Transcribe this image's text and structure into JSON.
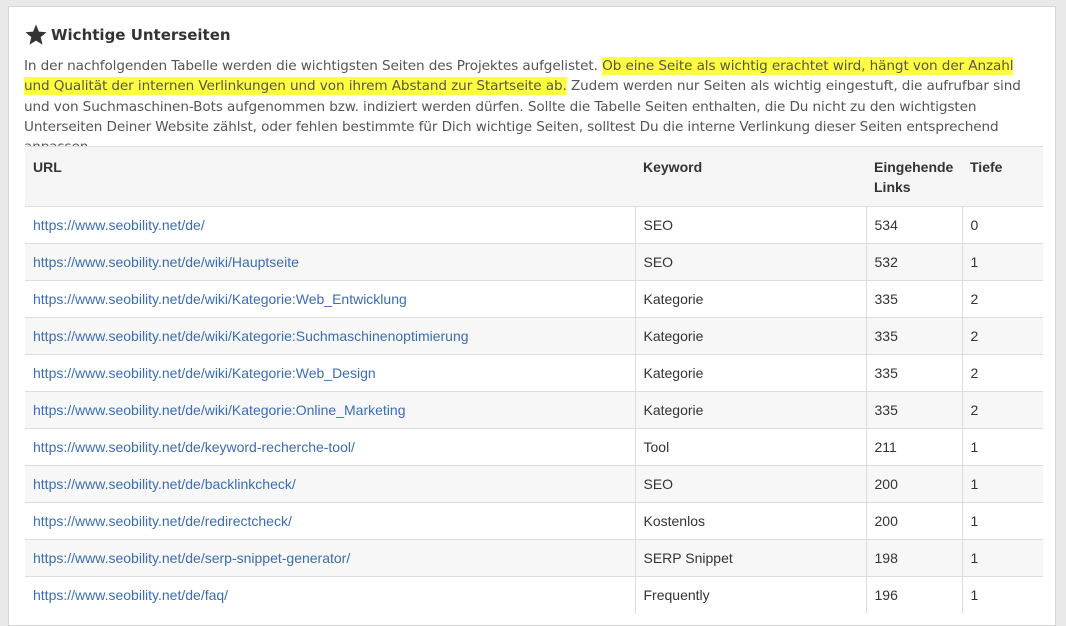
{
  "section": {
    "title": "Wichtige Unterseiten",
    "intro_part1": "In der nachfolgenden Tabelle werden die wichtigsten Seiten des Projektes aufgelistet. ",
    "intro_highlight": "Ob eine Seite als wichtig erachtet wird, hängt von der Anzahl und Qualität der internen Verlinkungen und von ihrem Abstand zur Startseite ab.",
    "intro_part2": " Zudem werden nur Seiten als wichtig eingestuft, die aufrufbar sind und von Suchmaschinen-Bots aufgenommen bzw. indiziert werden dürfen. Sollte die Tabelle Seiten enthalten, die Du nicht zu den wichtigsten Unterseiten Deiner Website zählst, oder fehlen bestimmte für Dich wichtige Seiten, solltest Du die interne Verlinkung dieser Seiten entsprechend anpassen.",
    "highlight_color": "#ffff40",
    "link_color": "#3a6db5"
  },
  "table": {
    "headers": {
      "url": "URL",
      "keyword": "Keyword",
      "links": "Eingehende Links",
      "depth": "Tiefe"
    },
    "rows": [
      {
        "url": "https://www.seobility.net/de/",
        "keyword": "SEO",
        "links": "534",
        "depth": "0"
      },
      {
        "url": "https://www.seobility.net/de/wiki/Hauptseite",
        "keyword": "SEO",
        "links": "532",
        "depth": "1"
      },
      {
        "url": "https://www.seobility.net/de/wiki/Kategorie:Web_Entwicklung",
        "keyword": "Kategorie",
        "links": "335",
        "depth": "2"
      },
      {
        "url": "https://www.seobility.net/de/wiki/Kategorie:Suchmaschinenoptimierung",
        "keyword": "Kategorie",
        "links": "335",
        "depth": "2"
      },
      {
        "url": "https://www.seobility.net/de/wiki/Kategorie:Web_Design",
        "keyword": "Kategorie",
        "links": "335",
        "depth": "2"
      },
      {
        "url": "https://www.seobility.net/de/wiki/Kategorie:Online_Marketing",
        "keyword": "Kategorie",
        "links": "335",
        "depth": "2"
      },
      {
        "url": "https://www.seobility.net/de/keyword-recherche-tool/",
        "keyword": "Tool",
        "links": "211",
        "depth": "1"
      },
      {
        "url": "https://www.seobility.net/de/backlinkcheck/",
        "keyword": "SEO",
        "links": "200",
        "depth": "1"
      },
      {
        "url": "https://www.seobility.net/de/redirectcheck/",
        "keyword": "Kostenlos",
        "links": "200",
        "depth": "1"
      },
      {
        "url": "https://www.seobility.net/de/serp-snippet-generator/",
        "keyword": "SERP Snippet",
        "links": "198",
        "depth": "1"
      },
      {
        "url": "https://www.seobility.net/de/faq/",
        "keyword": "Frequently",
        "links": "196",
        "depth": "1"
      }
    ]
  }
}
